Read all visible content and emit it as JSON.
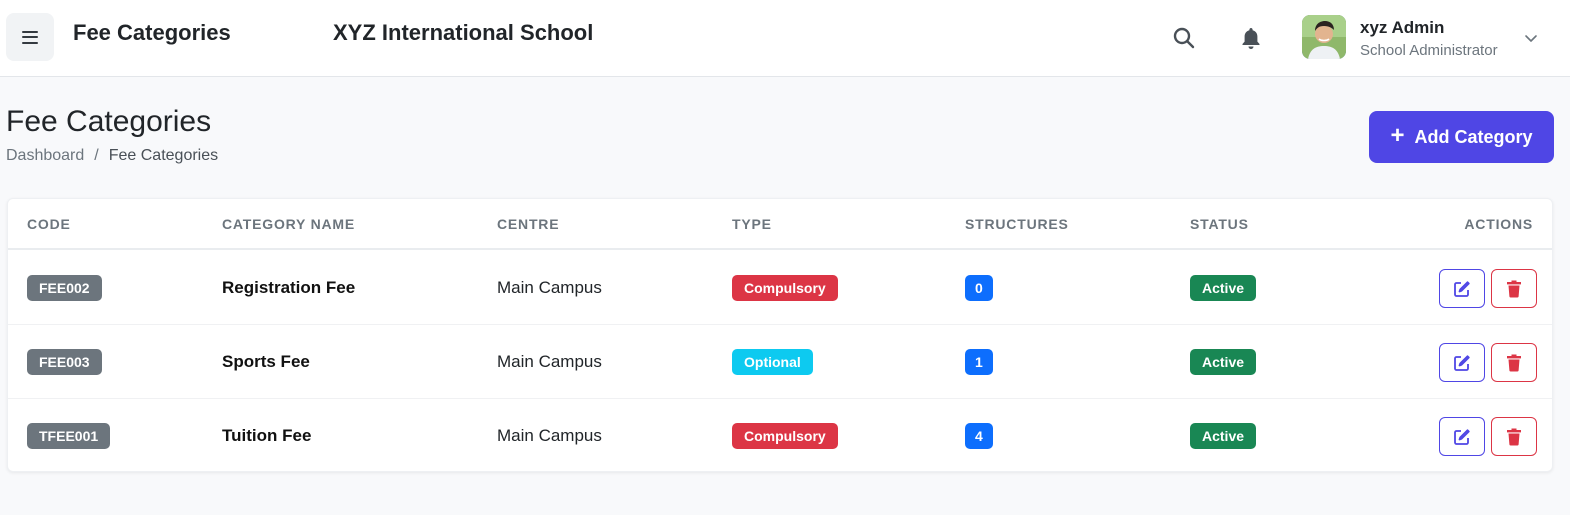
{
  "header": {
    "page_title": "Fee Categories",
    "school_name": "XYZ International School",
    "user": {
      "name": "xyz Admin",
      "role": "School Administrator"
    }
  },
  "page": {
    "title": "Fee Categories",
    "breadcrumb": [
      "Dashboard",
      "/",
      "Fee Categories"
    ],
    "add_button_label": "Add Category"
  },
  "table": {
    "columns": [
      "CODE",
      "CATEGORY NAME",
      "CENTRE",
      "TYPE",
      "STRUCTURES",
      "STATUS",
      "ACTIONS"
    ],
    "rows": [
      {
        "code": "FEE002",
        "name": "Registration Fee",
        "centre": "Main Campus",
        "type": "Compulsory",
        "type_color": "#dc3545",
        "structures": "0",
        "status": "Active"
      },
      {
        "code": "FEE003",
        "name": "Sports Fee",
        "centre": "Main Campus",
        "type": "Optional",
        "type_color": "#0dcaf0",
        "structures": "1",
        "status": "Active"
      },
      {
        "code": "TFEE001",
        "name": "Tuition Fee",
        "centre": "Main Campus",
        "type": "Compulsory",
        "type_color": "#dc3545",
        "structures": "4",
        "status": "Active"
      }
    ]
  },
  "colors": {
    "accent": "#4f46e5",
    "danger": "#dc3545",
    "success": "#198754",
    "info": "#0dcaf0",
    "primary": "#0d6efd",
    "secondary": "#6c757d"
  },
  "icons": [
    "menu-icon",
    "search-icon",
    "bell-icon",
    "avatar",
    "chevron-down-icon",
    "plus-icon",
    "edit-icon",
    "trash-icon"
  ]
}
